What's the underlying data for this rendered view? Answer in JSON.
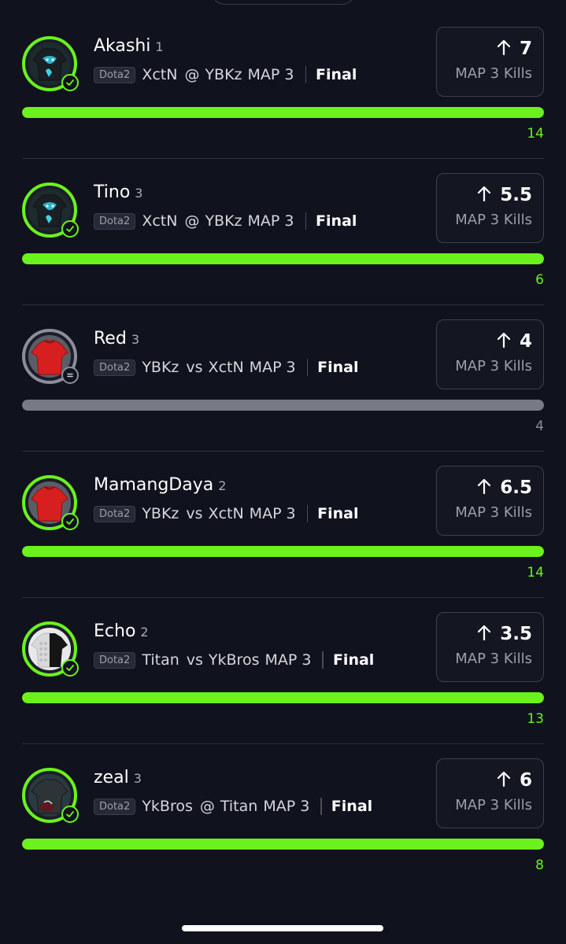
{
  "colors": {
    "background": "#10121d",
    "accent_green": "#6bf21c",
    "neutral_gray": "#787a86",
    "card_border": "#3e414d"
  },
  "stat_label": "MAP 3 Kills",
  "picks": [
    {
      "player": "Akashi",
      "slot": "1",
      "league": "Dota2",
      "team": "XctN",
      "connector": "@",
      "opponent": "YBKz",
      "map": "MAP 3",
      "status": "Final",
      "direction": "up",
      "line": "7",
      "result": "14",
      "progress": 1.0,
      "outcome": "won",
      "jersey": "dark-teal",
      "status_icon": "check-icon"
    },
    {
      "player": "Tino",
      "slot": "3",
      "league": "Dota2",
      "team": "XctN",
      "connector": "@",
      "opponent": "YBKz",
      "map": "MAP 3",
      "status": "Final",
      "direction": "up",
      "line": "5.5",
      "result": "6",
      "progress": 1.0,
      "outcome": "won",
      "jersey": "dark-teal",
      "status_icon": "check-icon"
    },
    {
      "player": "Red",
      "slot": "3",
      "league": "Dota2",
      "team": "YBKz",
      "connector": "vs",
      "opponent": "XctN",
      "map": "MAP 3",
      "status": "Final",
      "direction": "up",
      "line": "4",
      "result": "4",
      "progress": 1.0,
      "outcome": "push",
      "jersey": "red",
      "status_icon": "equals-icon"
    },
    {
      "player": "MamangDaya",
      "slot": "2",
      "league": "Dota2",
      "team": "YBKz",
      "connector": "vs",
      "opponent": "XctN",
      "map": "MAP 3",
      "status": "Final",
      "direction": "up",
      "line": "6.5",
      "result": "14",
      "progress": 1.0,
      "outcome": "won",
      "jersey": "red",
      "status_icon": "check-icon"
    },
    {
      "player": "Echo",
      "slot": "2",
      "league": "Dota2",
      "team": "Titan",
      "connector": "vs",
      "opponent": "YkBros",
      "map": "MAP 3",
      "status": "Final",
      "direction": "up",
      "line": "3.5",
      "result": "13",
      "progress": 1.0,
      "outcome": "won",
      "jersey": "black-white",
      "status_icon": "check-icon"
    },
    {
      "player": "zeal",
      "slot": "3",
      "league": "Dota2",
      "team": "YkBros",
      "connector": "@",
      "opponent": "Titan",
      "map": "MAP 3",
      "status": "Final",
      "direction": "up",
      "line": "6",
      "result": "8",
      "progress": 1.0,
      "outcome": "won",
      "jersey": "dark-slate",
      "status_icon": "check-icon"
    }
  ]
}
